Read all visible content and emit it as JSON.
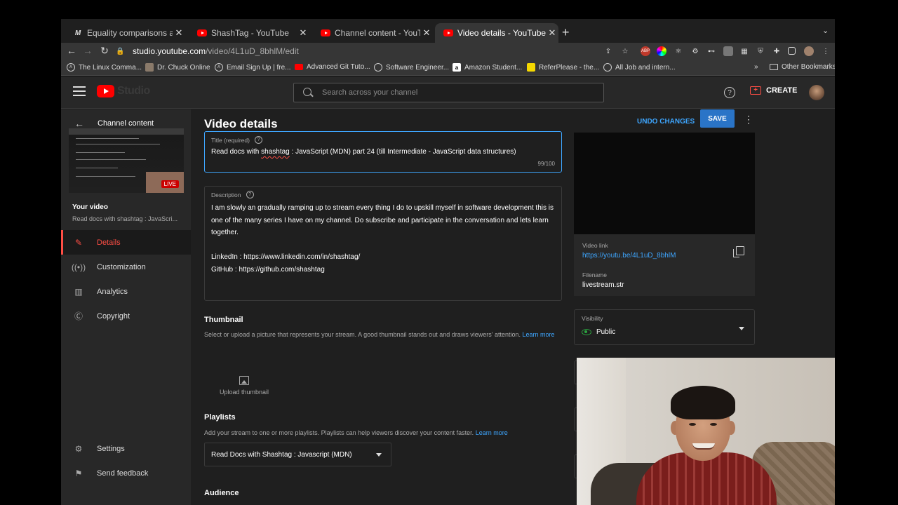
{
  "browser": {
    "tabs": [
      {
        "label": "Equality comparisons and same",
        "favicon": "M",
        "active": false
      },
      {
        "label": "ShashTag - YouTube",
        "favicon": "yt",
        "active": false
      },
      {
        "label": "Channel content - YouTube Stu",
        "favicon": "yt",
        "active": false
      },
      {
        "label": "Video details - YouTube Studio",
        "favicon": "yt",
        "active": true
      }
    ],
    "url_host": "studio.youtube.com",
    "url_path": "/video/4L1uD_8bhlM/edit",
    "extensions": [
      "abp",
      "color-wheel",
      "react",
      "gear",
      "glasses",
      "puzzle-ext",
      "bookmark-ext",
      "shield",
      "puzzle",
      "sidebar",
      "profile"
    ],
    "bookmarks": [
      {
        "label": "The Linux Comma...",
        "icon": "(A)"
      },
      {
        "label": "Dr. Chuck Online",
        "icon": "img"
      },
      {
        "label": "Email Sign Up | fre...",
        "icon": "(A)"
      },
      {
        "label": "Advanced Git Tuto...",
        "icon": "yt"
      },
      {
        "label": "Software Engineer...",
        "icon": "globe"
      },
      {
        "label": "Amazon Student...",
        "icon": "a"
      },
      {
        "label": "ReferPlease - the...",
        "icon": "rp"
      },
      {
        "label": "All Job and intern...",
        "icon": "globe"
      }
    ],
    "more_bookmarks": "»",
    "other_bookmarks": "Other Bookmarks"
  },
  "header": {
    "logo_text": "Studio",
    "search_placeholder": "Search across your channel",
    "help": "?",
    "create_label": "CREATE"
  },
  "sidebar": {
    "back_label": "Channel content",
    "live_badge": "LIVE",
    "your_video": "Your video",
    "video_title": "Read docs with shashtag : JavaScri...",
    "items": [
      {
        "label": "Details",
        "icon": "pencil-icon",
        "active": true
      },
      {
        "label": "Customization",
        "icon": "broadcast-icon",
        "active": false
      },
      {
        "label": "Analytics",
        "icon": "analytics-icon",
        "active": false
      },
      {
        "label": "Copyright",
        "icon": "copyright-icon",
        "active": false
      }
    ],
    "settings": "Settings",
    "feedback": "Send feedback"
  },
  "main": {
    "page_title": "Video details",
    "undo_label": "UNDO CHANGES",
    "save_label": "SAVE",
    "title_field": {
      "label": "Title (required)",
      "value_before": "Read docs with ",
      "value_misspelled": "shashtag",
      "value_after": " : JavaScript (MDN) part 24 (till Intermediate - JavaScript data structures)",
      "counter": "99/100"
    },
    "description_field": {
      "label": "Description",
      "value": "I am slowly an gradually ramping up to stream every thing I do to upskill myself in software development this is one of the many series I have on my channel. Do subscribe and participate in the conversation and lets learn together.\n\nLinkedIn : https://www.linkedin.com/in/shashtag/\nGitHub : https://github.com/shashtag"
    },
    "thumbnail": {
      "heading": "Thumbnail",
      "text": "Select or upload a picture that represents your stream. A good thumbnail stands out and draws viewers' attention.",
      "learn_more": "Learn more",
      "upload_label": "Upload thumbnail"
    },
    "playlists": {
      "heading": "Playlists",
      "text": "Add your stream to one or more playlists. Playlists can help viewers discover your content faster.",
      "learn_more": "Learn more",
      "selected": "Read Docs with Shashtag : Javascript (MDN)"
    },
    "audience_heading": "Audience"
  },
  "panel": {
    "video_link_label": "Video link",
    "video_link": "https://youtu.be/4L1uD_8bhlM",
    "filename_label": "Filename",
    "filename": "livestream.str",
    "visibility_label": "Visibility",
    "visibility_value": "Public"
  },
  "colors": {
    "accent_blue": "#3ea6ff",
    "brand_red": "#ff0000",
    "active_red": "#ff4e45",
    "public_green": "#2ba640"
  }
}
